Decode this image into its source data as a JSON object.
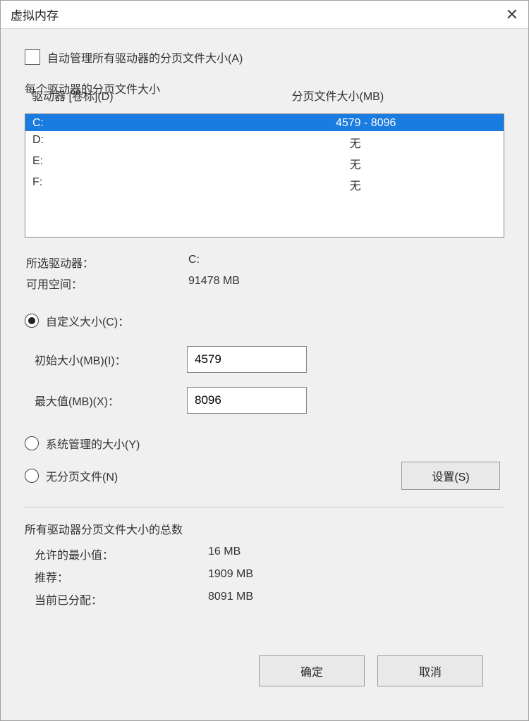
{
  "title": "虚拟内存",
  "checkbox_auto_manage": "自动管理所有驱动器的分页文件大小(A)",
  "per_drive_label": "每个驱动器的分页文件大小",
  "columns": {
    "drive": "驱动器 [卷标](D)",
    "size": "分页文件大小(MB)"
  },
  "drives": [
    {
      "name": "C:",
      "size": "4579 - 8096",
      "selected": true
    },
    {
      "name": "D:",
      "size": "无",
      "selected": false
    },
    {
      "name": "E:",
      "size": "无",
      "selected": false
    },
    {
      "name": "F:",
      "size": "无",
      "selected": false
    }
  ],
  "selected_drive": {
    "label": "所选驱动器：",
    "value": "C:",
    "space_label": "可用空间：",
    "space_value": "91478 MB"
  },
  "size_options": {
    "custom_label": "自定义大小(C)：",
    "initial_label": "初始大小(MB)(I)：",
    "initial_value": "4579",
    "max_label": "最大值(MB)(X)：",
    "max_value": "8096",
    "system_managed_label": "系统管理的大小(Y)",
    "no_paging_label": "无分页文件(N)"
  },
  "set_button": "设置(S)",
  "totals": {
    "title": "所有驱动器分页文件大小的总数",
    "min_label": "允许的最小值：",
    "min_value": "16 MB",
    "recommended_label": "推荐：",
    "recommended_value": "1909 MB",
    "current_label": "当前已分配：",
    "current_value": "8091 MB"
  },
  "buttons": {
    "ok": "确定",
    "cancel": "取消"
  }
}
